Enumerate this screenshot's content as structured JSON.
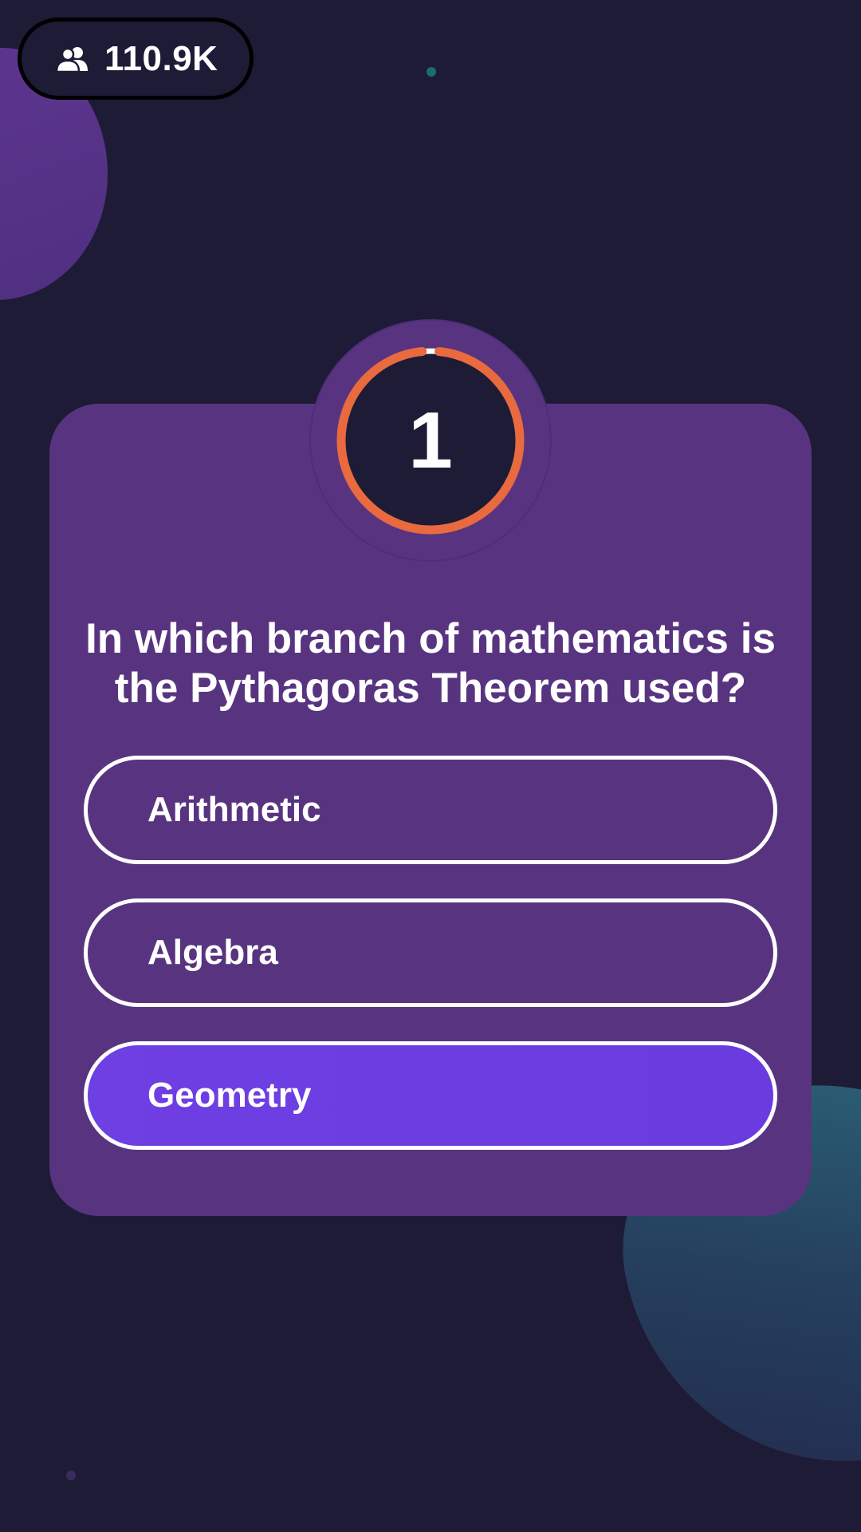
{
  "header": {
    "viewer_icon": "users-icon",
    "viewer_count": "110.9K"
  },
  "timer": {
    "value": "1",
    "remaining_fraction": 0.97,
    "ring_color": "#e86a3e",
    "track_color": "#ffffff"
  },
  "question": {
    "text": "In which branch of mathematics is the Pythagoras Theorem used?"
  },
  "options": [
    {
      "label": "Arithmetic",
      "selected": false
    },
    {
      "label": "Algebra",
      "selected": false
    },
    {
      "label": "Geometry",
      "selected": true
    }
  ],
  "colors": {
    "background": "#1e1b36",
    "card": "#583480",
    "selected_option": "#6b3de1",
    "accent": "#e86a3e"
  }
}
